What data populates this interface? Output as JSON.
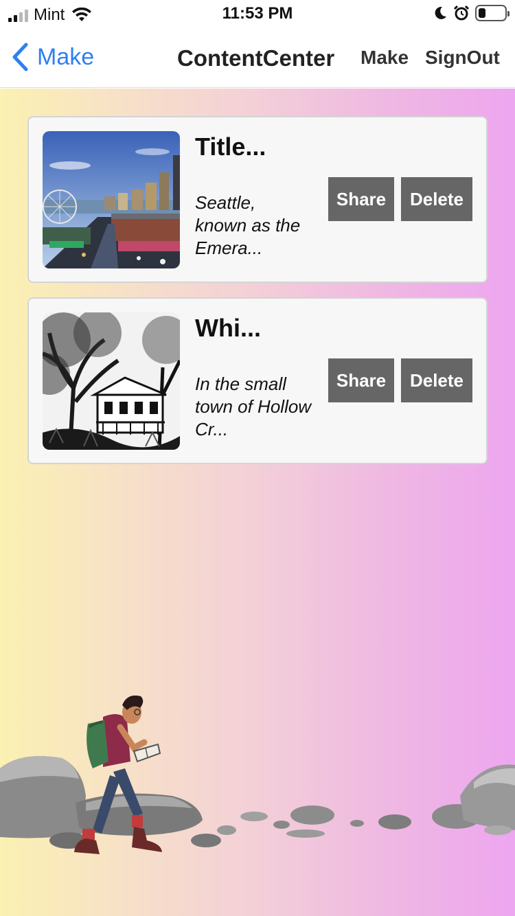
{
  "status_bar": {
    "carrier": "Mint",
    "time": "11:53 PM"
  },
  "nav": {
    "back_label": "Make",
    "title": "ContentCenter",
    "make_label": "Make",
    "signout_label": "SignOut"
  },
  "cards": [
    {
      "title": "Title...",
      "description": "Seattle, known as the Emera...",
      "share_label": "Share",
      "delete_label": "Delete",
      "thumbnail": "seattle-city-photo"
    },
    {
      "title": "Whi...",
      "description": "In the small town of Hollow Cr...",
      "share_label": "Share",
      "delete_label": "Delete",
      "thumbnail": "old-house-sketch"
    }
  ],
  "colors": {
    "accent": "#2f7ff0",
    "button_bg": "#666666",
    "gradient_left": "#fbf1b2",
    "gradient_right": "#eda6f0"
  }
}
